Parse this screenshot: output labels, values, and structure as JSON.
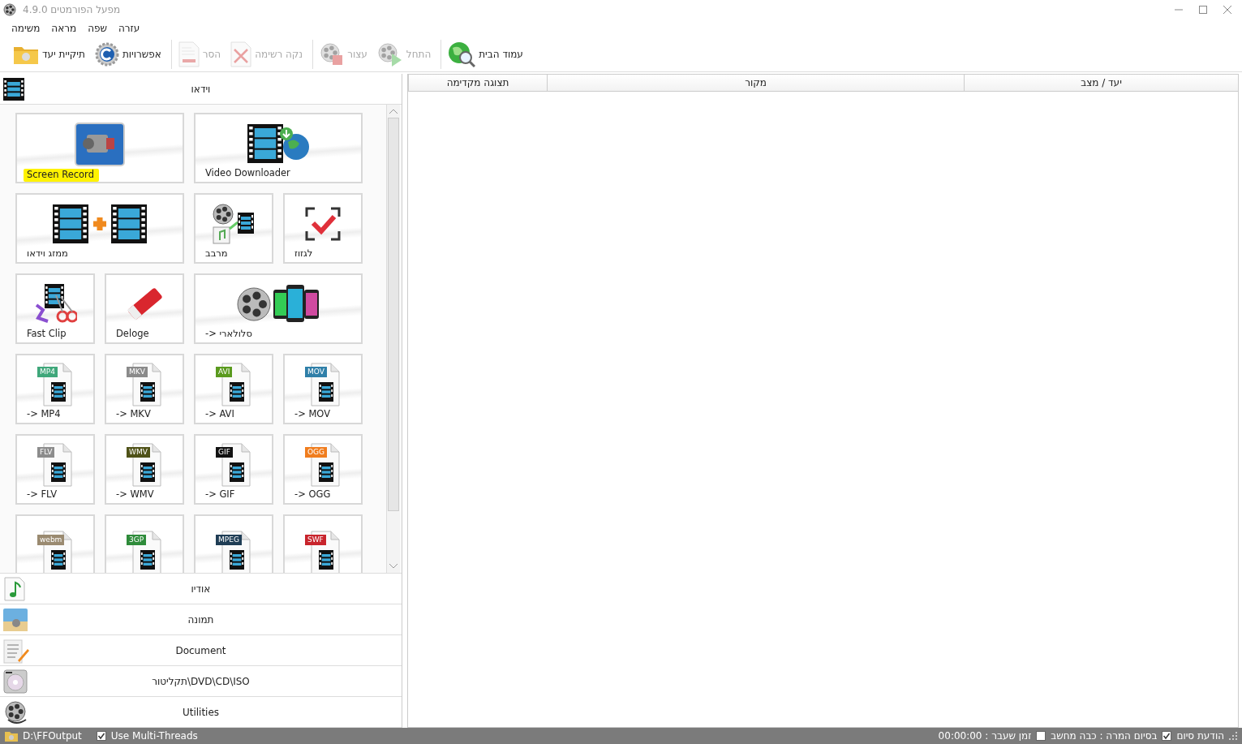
{
  "window": {
    "title": "מפעל הפורמטים 4.9.0"
  },
  "menu": [
    "עזרה",
    "שפה",
    "מראה",
    "משימה"
  ],
  "toolbar_groups": [
    {
      "buttons": [
        {
          "label": "עמוד הבית",
          "disabled": false
        }
      ]
    },
    {
      "buttons": [
        {
          "label": "התחל",
          "disabled": true
        },
        {
          "label": "עצור",
          "disabled": true
        }
      ]
    },
    {
      "buttons": [
        {
          "label": "נקה רשימה",
          "disabled": true
        },
        {
          "label": "הסר",
          "disabled": true
        }
      ]
    },
    {
      "buttons": [
        {
          "label": "אפשרויות",
          "disabled": false
        },
        {
          "label": "תיקיית יעד",
          "disabled": false
        }
      ]
    }
  ],
  "categories": [
    {
      "label": "וידאו",
      "tiles": [
        {
          "label": "Video Downloader",
          "wide": true,
          "highlighted": false
        },
        {
          "label": "Screen Record",
          "wide": true,
          "highlighted": true
        },
        {
          "label": "לגזוז",
          "wide": false,
          "highlighted": false
        },
        {
          "label": "מרבב",
          "wide": false,
          "highlighted": false
        },
        {
          "label": "ממזג וידאו",
          "wide": true,
          "highlighted": false
        },
        {
          "label": "-> סלולארי",
          "wide": true,
          "highlighted": false
        },
        {
          "label": "Deloge",
          "wide": false,
          "highlighted": false
        },
        {
          "label": "Fast Clip",
          "wide": false,
          "highlighted": false
        },
        {
          "label": "-> MOV",
          "wide": false,
          "highlighted": false,
          "badge": "MOV",
          "color": "#2f7fa8"
        },
        {
          "label": "-> AVI",
          "wide": false,
          "highlighted": false,
          "badge": "AVI",
          "color": "#5a9a1e"
        },
        {
          "label": "-> MKV",
          "wide": false,
          "highlighted": false,
          "badge": "MKV",
          "color": "#8a8a8a"
        },
        {
          "label": "-> MP4",
          "wide": false,
          "highlighted": false,
          "badge": "MP4",
          "color": "#3fa77a"
        },
        {
          "label": "-> OGG",
          "wide": false,
          "highlighted": false,
          "badge": "OGG",
          "color": "#f07d1e"
        },
        {
          "label": "-> GIF",
          "wide": false,
          "highlighted": false,
          "badge": "GIF",
          "color": "#111111"
        },
        {
          "label": "-> WMV",
          "wide": false,
          "highlighted": false,
          "badge": "WMV",
          "color": "#4f5218"
        },
        {
          "label": "-> FLV",
          "wide": false,
          "highlighted": false,
          "badge": "FLV",
          "color": "#8c8c8c"
        },
        {
          "wide": false,
          "badge": "SWF",
          "color": "#c8242c"
        },
        {
          "wide": false,
          "badge": "MPEG",
          "color": "#1f3d55"
        },
        {
          "wide": false,
          "badge": "3GP",
          "color": "#2e8b3a"
        },
        {
          "wide": false,
          "badge": "webm",
          "color": "#9a8a70"
        }
      ]
    },
    {
      "label": "אודיו"
    },
    {
      "label": "תמונה"
    },
    {
      "label": "Document"
    },
    {
      "label": "תקליטור\\DVD\\CD\\ISO"
    },
    {
      "label": "Utilities"
    }
  ],
  "task_table": {
    "columns": [
      "יעד / מצב",
      "מקור",
      "תצוגה מקדימה"
    ]
  },
  "status_bar": {
    "output_folder": "D:\\FFOutput",
    "multi_threads": {
      "label": "Use Multi-Threads",
      "checked": true
    },
    "notify": {
      "label": "הודעת סיום",
      "checked": true
    },
    "shutdown": {
      "label": "בסיום המרה : כבה מחשב",
      "checked": false
    },
    "elapsed": "זמן שעבר : 00:00:00"
  }
}
